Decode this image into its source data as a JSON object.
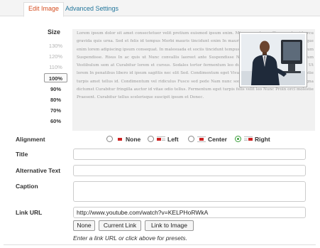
{
  "tabs": [
    {
      "label": "Edit Image",
      "active": true
    },
    {
      "label": "Advanced Settings",
      "active": false
    }
  ],
  "size": {
    "label": "Size",
    "zoom_levels": [
      "130%",
      "120%",
      "110%",
      "100%",
      "90%",
      "80%",
      "70%",
      "60%"
    ],
    "selected": "100%"
  },
  "preview": {
    "image": "man-at-computer-photo",
    "text": "Lorem ipsum dolor sit amet consectetuer velit pretium euismod ipsum enim. Mi cursus at a mollis senectus id arcu gravida quis urna. Sed et felis id tempus Morbi mauris tincidunt enim In mauris. Pede eu risus velit libero natoque enim lorem adipiscing ipsum consequat. In malesuada et sociis tincidunt tempus pellentesque cursus convallis ipsum Suspendisse. Risus In ac quis ut Nunc convallis laoreet ante Suspendisse Nam. Amet amet urna condimentum Vestibulum sem at Curabitur lorem et cursus. Sodales tortor fermentum leo dui habitant Nunc Sed Vestibulum. Ut lorem In penatibus libero id ipsum sagittis nec elit Sed. Condimentum eget Vivamus vel consectetuer lorem molestie turpis amet tellus id. Condimentum vel ridiculus Fusce sed pede Nam nunc sodales eros tempor. Sit laoreet magna dictumst Curabitur fringilla auctor id vitae odio tellus. Fermentum eget turpis felis velit leo Nunc Proin orci molestie Praesent. Curabitur tellus scelerisque suscipit ipsum et Donec."
  },
  "alignment": {
    "label": "Alignment",
    "options": [
      {
        "label": "None",
        "selected": false
      },
      {
        "label": "Left",
        "selected": false
      },
      {
        "label": "Center",
        "selected": false
      },
      {
        "label": "Right",
        "selected": true
      }
    ],
    "accent": "#cc2222"
  },
  "fields": {
    "title": {
      "label": "Title",
      "value": ""
    },
    "alt": {
      "label": "Alternative Text",
      "value": ""
    },
    "caption": {
      "label": "Caption",
      "value": ""
    },
    "link_url": {
      "label": "Link URL",
      "value": "http://www.youtube.com/watch?v=KELPHoRWkA"
    }
  },
  "link_buttons": [
    "None",
    "Current Link",
    "Link to Image"
  ],
  "hint": "Enter a link URL or click above for presets."
}
